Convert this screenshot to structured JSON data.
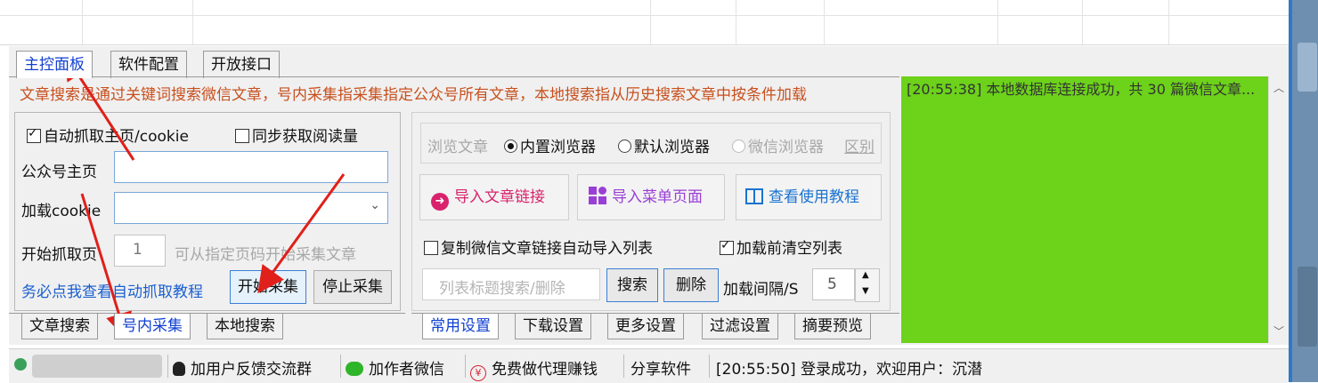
{
  "top_tabs": [
    "主控面板",
    "软件配置",
    "开放接口"
  ],
  "notice": "文章搜索是通过关键词搜索微信文章，号内采集指采集指定公众号所有文章，本地搜索指从历史搜索文章中按条件加载",
  "left_group": {
    "auto_fetch_label": "自动抓取主页/cookie",
    "auto_fetch_checked": true,
    "sync_read_label": "同步获取阅读量",
    "sync_read_checked": false,
    "account_home_label": "公众号主页",
    "account_home_value": "",
    "load_cookie_label": "加载cookie",
    "load_cookie_value": "",
    "start_page_label": "开始抓取页",
    "start_page_value": "1",
    "start_page_hint": "可从指定页码开始采集文章",
    "tutorial_link": "务必点我查看自动抓取教程",
    "start_button": "开始采集",
    "stop_button": "停止采集"
  },
  "left_bottom_tabs": [
    "文章搜索",
    "号内采集",
    "本地搜索"
  ],
  "browse": {
    "label": "浏览文章",
    "options": [
      "内置浏览器",
      "默认浏览器",
      "微信浏览器"
    ],
    "selected": "内置浏览器",
    "diff_link": "区别"
  },
  "action_buttons": [
    "导入文章链接",
    "导入菜单页面",
    "查看使用教程"
  ],
  "copy_link_label": "复制微信文章链接自动导入列表",
  "copy_link_checked": false,
  "clear_before_label": "加载前清空列表",
  "clear_before_checked": true,
  "search_placeholder": "列表标题搜索/删除",
  "search_button": "搜索",
  "delete_button": "删除",
  "interval_label": "加载间隔/S",
  "interval_value": "5",
  "right_bottom_tabs": [
    "常用设置",
    "下载设置",
    "更多设置",
    "过滤设置",
    "摘要预览"
  ],
  "log_text": "[20:55:38] 本地数据库连接成功，共 30 篇微信文章...",
  "status": {
    "feedback": "加用户反馈交流群",
    "wechat": "加作者微信",
    "agent": "免费做代理赚钱",
    "share": "分享软件",
    "message": "[20:55:50] 登录成功，欢迎用户：沉潜"
  },
  "colors": {
    "notice": "#c8501e",
    "link": "#1a5fd0",
    "log_bg": "#6cd21a",
    "arrow": "#e0201a"
  }
}
